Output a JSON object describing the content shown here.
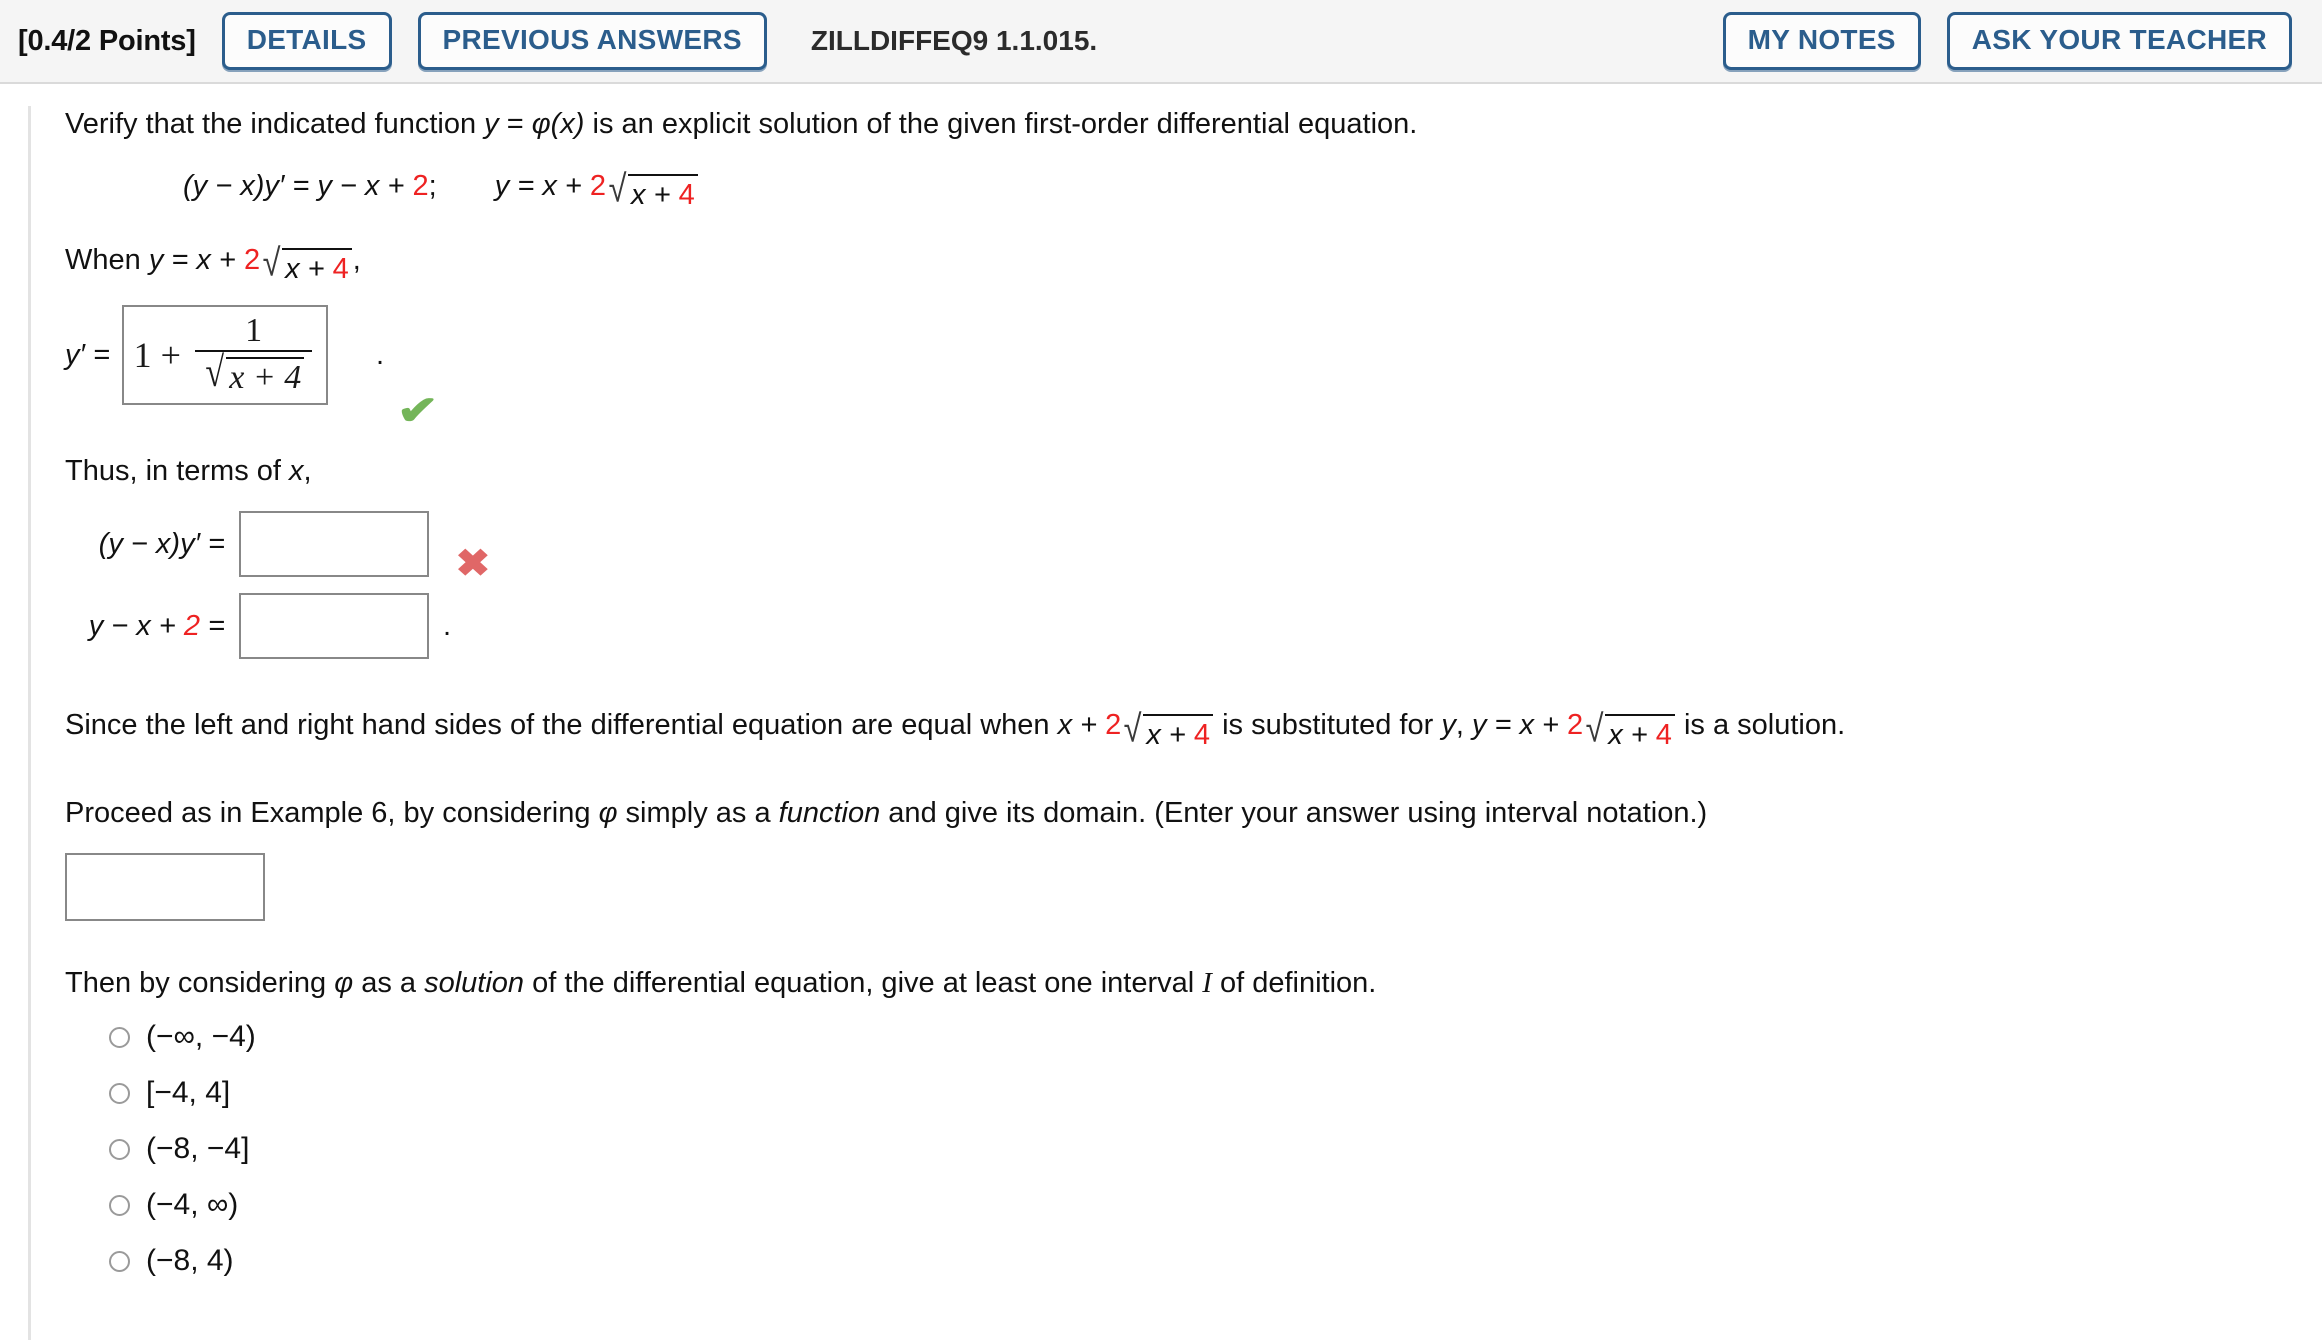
{
  "header": {
    "points": "[0.4/2 Points]",
    "details_label": "DETAILS",
    "previous_answers_label": "PREVIOUS ANSWERS",
    "question_id": "ZILLDIFFEQ9 1.1.015.",
    "my_notes_label": "MY NOTES",
    "ask_your_teacher_label": "ASK YOUR TEACHER",
    "accent_color": "#2b5d8c",
    "background_color": "#f5f5f5"
  },
  "problem": {
    "prompt": "Verify that the indicated function y = φ(x) is an explicit solution of the given first-order differential equation.",
    "prompt_parts": {
      "a": "Verify that the indicated function ",
      "y": "y",
      "eq": " = ",
      "phi": "φ",
      "paren_x": "(x)",
      "b": " is an explicit solution of the given first-order differential equation."
    },
    "given_equation": {
      "lhs": "(y − x)y′ = y − x + ",
      "lhs_red": "2",
      "semicolon": ";",
      "rhs_start": "y = x + ",
      "rhs_coef": "2",
      "radicand_x": "x + ",
      "radicand_num": "4"
    },
    "when_line": {
      "prefix": "When ",
      "y": "y",
      "eq": " = x + ",
      "coef": "2",
      "radicand_x": "x + ",
      "radicand_num": "4",
      "comma": ","
    },
    "yprime_line": {
      "label": "y′ =",
      "answer_one": "1 +",
      "fraction_numerator": "1",
      "fraction_denominator_radicand": "x + 4",
      "radical_glyph": "√",
      "period": ".",
      "mark": "✔",
      "mark_status": "correct",
      "mark_color": "#74b559"
    },
    "thus_line": "Thus, in terms of x,",
    "thus_line_parts": {
      "a": "Thus, in terms of ",
      "x": "x",
      "b": ","
    },
    "equation_rows": [
      {
        "label_plain": "(y − x)y′  =",
        "label_parts": {
          "a": "(",
          "y1": "y",
          "b": " − ",
          "x1": "x",
          "c": ")",
          "y2": "y′",
          "d": " ="
        },
        "value": "",
        "placeholder": "",
        "mark": "✖",
        "mark_status": "incorrect",
        "mark_color": "#e06767",
        "trailing": ""
      },
      {
        "label_plain": "y − x + 2  =",
        "label_parts": {
          "a": "",
          "y1": "y",
          "b": " − ",
          "x1": "x",
          "c": " + ",
          "red": "2",
          "d": " ="
        },
        "value": "",
        "placeholder": "",
        "mark": "",
        "mark_status": "none",
        "mark_color": "",
        "trailing": "."
      }
    ],
    "since_line": {
      "a": "Since the left and right hand sides of the differential equation are equal when ",
      "sub1_prefix": "x + ",
      "sub1_coef": "2",
      "sub1_radicand_x": "x + ",
      "sub1_radicand_num": "4",
      "b": " is substituted for ",
      "y1": "y",
      "c": ", ",
      "y2": "y",
      "d": " = x + ",
      "sub2_coef": "2",
      "sub2_radicand_x": "x + ",
      "sub2_radicand_num": "4",
      "e": " is a solution."
    },
    "proceed_line": {
      "a": "Proceed as in Example 6, by considering ",
      "phi": "φ",
      "b": " simply as a ",
      "italic": "function",
      "c": " and give its domain. (Enter your answer using interval notation.)"
    },
    "domain_answer": {
      "value": "",
      "placeholder": ""
    },
    "then_line": {
      "a": "Then by considering ",
      "phi": "φ",
      "b": " as a ",
      "italic": "solution",
      "c": " of the differential equation, give at least one interval ",
      "I": "I",
      "d": " of definition."
    },
    "interval_options": [
      {
        "label": "(−∞, −4)",
        "selected": false
      },
      {
        "label": "[−4, 4]",
        "selected": false
      },
      {
        "label": "(−8, −4]",
        "selected": false
      },
      {
        "label": "(−4, ∞)",
        "selected": false
      },
      {
        "label": "(−8, 4)",
        "selected": false
      }
    ]
  }
}
